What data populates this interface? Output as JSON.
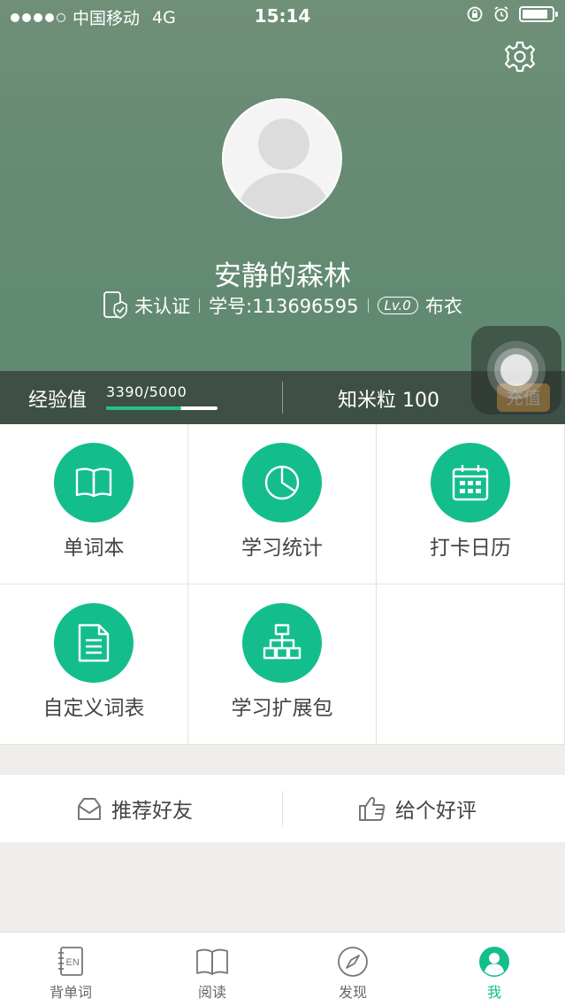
{
  "status_bar": {
    "carrier": "中国移动",
    "network": "4G",
    "time": "15:14"
  },
  "profile": {
    "username": "安静的森林",
    "verification": "未认证",
    "student_id": "学号:113696595",
    "level": "Lv.0",
    "title": "布衣"
  },
  "stats": {
    "exp_label": "经验值",
    "exp_text": "3390/5000",
    "exp_progress": 0.678,
    "coins_label": "知米粒 100",
    "recharge_label": "充值"
  },
  "grid": [
    {
      "label": "单词本",
      "icon": "book-icon"
    },
    {
      "label": "学习统计",
      "icon": "pie-chart-icon"
    },
    {
      "label": "打卡日历",
      "icon": "calendar-icon"
    },
    {
      "label": "自定义词表",
      "icon": "document-icon"
    },
    {
      "label": "学习扩展包",
      "icon": "hierarchy-icon"
    }
  ],
  "actions": {
    "recommend": "推荐好友",
    "review": "给个好评"
  },
  "tabbar": {
    "items": [
      {
        "label": "背单词",
        "icon": "vocab-book-icon"
      },
      {
        "label": "阅读",
        "icon": "open-book-icon"
      },
      {
        "label": "发现",
        "icon": "compass-icon"
      },
      {
        "label": "我",
        "icon": "profile-icon"
      }
    ]
  },
  "colors": {
    "accent": "#13be8c",
    "header": "#668a73",
    "recharge": "#e8a84e"
  }
}
